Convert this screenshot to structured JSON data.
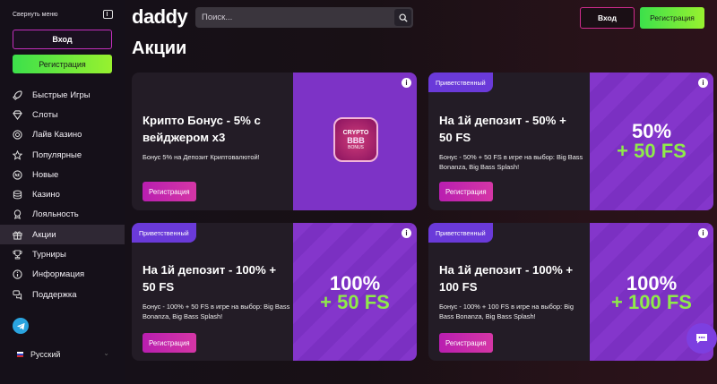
{
  "sidebar": {
    "collapse_label": "Свернуть меню",
    "login_label": "Вход",
    "register_label": "Регистрация",
    "items": [
      {
        "label": "Быстрые Игры",
        "icon": "rocket-icon"
      },
      {
        "label": "Слоты",
        "icon": "diamond-icon"
      },
      {
        "label": "Лайв Казино",
        "icon": "chip-icon"
      },
      {
        "label": "Популярные",
        "icon": "star-icon"
      },
      {
        "label": "Новые",
        "icon": "new-badge-icon"
      },
      {
        "label": "Казино",
        "icon": "coins-icon"
      },
      {
        "label": "Лояльность",
        "icon": "medal-icon"
      },
      {
        "label": "Акции",
        "icon": "gift-icon",
        "active": true
      },
      {
        "label": "Турниры",
        "icon": "trophy-icon"
      },
      {
        "label": "Информация",
        "icon": "info-icon"
      },
      {
        "label": "Поддержка",
        "icon": "chat-icon"
      }
    ],
    "language": "Русский"
  },
  "header": {
    "logo_text": "daddy",
    "search_placeholder": "Поиск...",
    "login_label": "Вход",
    "register_label": "Регистрация"
  },
  "page": {
    "title": "Акции"
  },
  "promos": [
    {
      "title": "Крипто Бонус - 5% с вейджером x3",
      "description": "Бонус 5% на Депозит Криптовалютой!",
      "button": "Регистрация",
      "badge": "",
      "banner_logo": [
        "CRYPTO",
        "BBB",
        "BONUS"
      ]
    },
    {
      "title": "На 1й депозит - 50% + 50 FS",
      "description": "Бонус - 50% + 50 FS в игре на выбор: Big Bass Bonanza, Big Bass Splash!",
      "button": "Регистрация",
      "badge": "Приветственный",
      "banner_line1": "50%",
      "banner_line2": "+ 50 FS"
    },
    {
      "title": "На 1й депозит - 100% + 50 FS",
      "description": "Бонус - 100% + 50 FS в игре на выбор: Big Bass Bonanza, Big Bass Splash!",
      "button": "Регистрация",
      "badge": "Приветственный",
      "banner_line1": "100%",
      "banner_line2": "+ 50 FS"
    },
    {
      "title": "На 1й депозит - 100% + 100 FS",
      "description": "Бонус - 100% + 100 FS в игре на выбор: Big Bass Bonanza, Big Bass Splash!",
      "button": "Регистрация",
      "badge": "Приветственный",
      "banner_line1": "100%",
      "banner_line2": "+ 100 FS"
    }
  ],
  "colors": {
    "accent_green": "#7ee83a",
    "accent_pink": "#c42fbd",
    "badge_purple": "#6a3ad9",
    "banner_purple": "#7d33c6",
    "telegram_blue": "#2aa4df"
  }
}
